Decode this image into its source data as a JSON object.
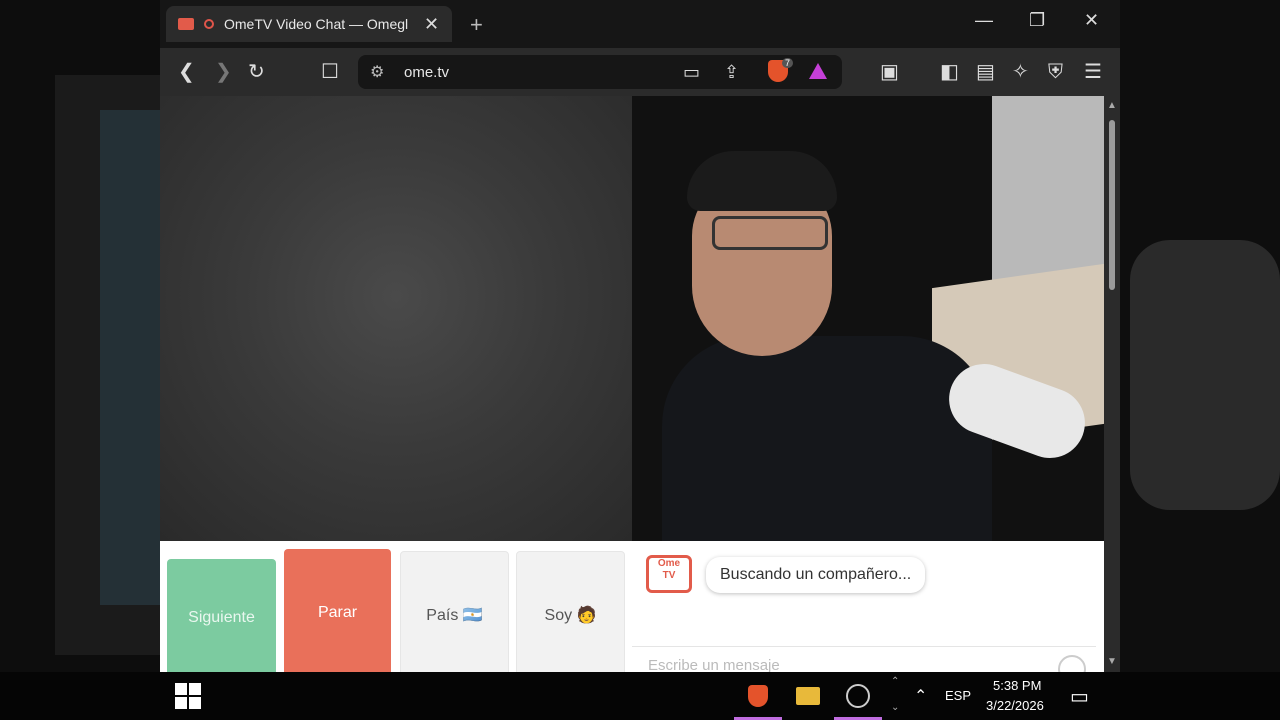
{
  "tab": {
    "title": "OmeTV Video Chat — Omegl"
  },
  "window": {
    "minimize": "—",
    "restore": "❐",
    "close": "✕"
  },
  "toolbar": {
    "url": "ome.tv",
    "brave_badge": "7"
  },
  "buttons": {
    "next": "Siguiente",
    "stop": "Parar",
    "country": "País 🇦🇷",
    "me": "Soy 🧑"
  },
  "chat": {
    "logo_top": "Ome",
    "logo_bottom": "TV",
    "status": "Buscando un compañero...",
    "placeholder": "Escribe un mensaje"
  },
  "taskbar": {
    "language": "ESP",
    "time": "5:38 PM",
    "date": "3/22/2026"
  },
  "colors": {
    "next": "#7ccba0",
    "stop": "#e9705a",
    "accent": "#e25b4a"
  }
}
